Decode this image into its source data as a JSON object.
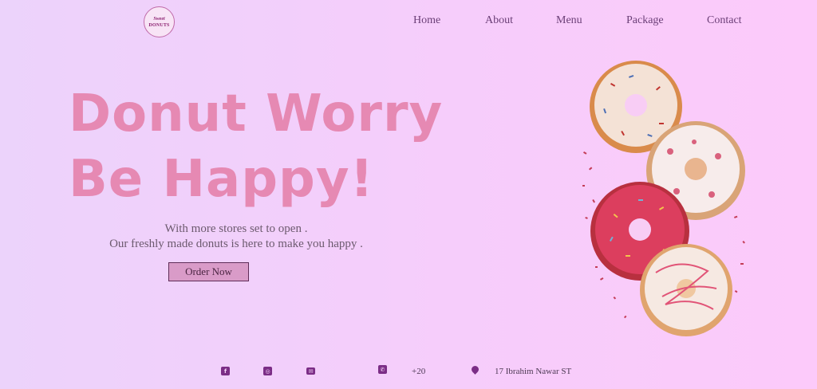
{
  "brand": {
    "logo_line1": "Sweet",
    "logo_line2": "DONUTS"
  },
  "nav": {
    "items": [
      {
        "label": "Home"
      },
      {
        "label": "About"
      },
      {
        "label": "Menu"
      },
      {
        "label": "Package"
      },
      {
        "label": "Contact"
      }
    ]
  },
  "hero": {
    "headline_line1": "Donut Worry",
    "headline_line2": "Be Happy!",
    "sub_line1": "With more stores set to open .",
    "sub_line2": "Our freshly made donuts is here to make you happy .",
    "button_label": "Order Now"
  },
  "footer": {
    "icons": [
      "facebook-icon",
      "instagram-icon",
      "envelope-icon",
      "phone-icon",
      "location-pin-icon"
    ],
    "phone": "+20",
    "address": "17 Ibrahim Nawar ST"
  },
  "colors": {
    "headline": "#e689b3",
    "accent": "#7b2d86",
    "button_bg": "#d99bc8"
  }
}
